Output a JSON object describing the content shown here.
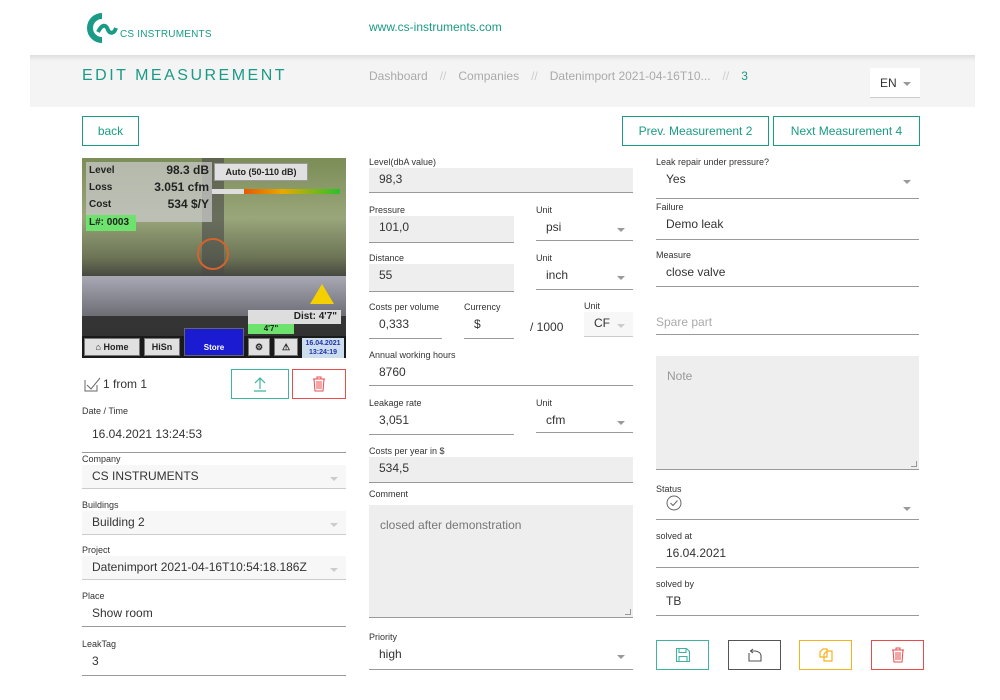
{
  "header": {
    "logo_text": "CS INSTRUMENTS",
    "site_url": "www.cs-instruments.com"
  },
  "titlebar": {
    "title": "EDIT MEASUREMENT",
    "breadcrumb": [
      "Dashboard",
      "Companies",
      "Datenimport 2021-04-16T10...",
      "3"
    ],
    "breadcrumb_separator": "//",
    "language": "EN"
  },
  "nav": {
    "back_label": "back",
    "prev_label": "Prev. Measurement 2",
    "next_label": "Next Measurement 4"
  },
  "photo": {
    "level_label": "Level",
    "level_value": "98.3 dB",
    "loss_label": "Loss",
    "loss_value": "3.051 cfm",
    "cost_label": "Cost",
    "cost_value": "534 $/Y",
    "leak_number": "L#: 0003",
    "range": "Auto (50-110 dB)",
    "distance": "Dist: 4'7\"",
    "distance_short": "4'7\"",
    "home_label": "Home",
    "hisn_label": "HiSn",
    "store_label": "Store",
    "date": "16.04.2021",
    "time": "13:24:19"
  },
  "images": {
    "count_text": "1 from 1"
  },
  "left_fields": {
    "datetime": {
      "label": "Date / Time",
      "value": "16.04.2021 13:24:53"
    },
    "company": {
      "label": "Company",
      "value": "CS INSTRUMENTS"
    },
    "buildings": {
      "label": "Buildings",
      "value": "Building 2"
    },
    "project": {
      "label": "Project",
      "value": "Datenimport 2021-04-16T10:54:18.186Z"
    },
    "place": {
      "label": "Place",
      "value": "Show room"
    },
    "leaktag": {
      "label": "LeakTag",
      "value": "3"
    }
  },
  "middle_fields": {
    "level": {
      "label": "Level(dbA value)",
      "value": "98,3"
    },
    "pressure": {
      "label": "Pressure",
      "value": "101,0"
    },
    "pressure_unit": {
      "label": "Unit",
      "value": "psi"
    },
    "distance": {
      "label": "Distance",
      "value": "55"
    },
    "distance_unit": {
      "label": "Unit",
      "value": "inch"
    },
    "costs_per_volume": {
      "label": "Costs per volume",
      "value": "0,333"
    },
    "currency": {
      "label": "Currency",
      "value": "$"
    },
    "per_volume": "/ 1000",
    "volume_unit": {
      "label": "Unit",
      "value": "CF"
    },
    "working_hours": {
      "label": "Annual working hours",
      "value": "8760"
    },
    "leakage_rate": {
      "label": "Leakage rate",
      "value": "3,051"
    },
    "leakage_unit": {
      "label": "Unit",
      "value": "cfm"
    },
    "costs_per_year": {
      "label": "Costs per year in $",
      "value": "534,5"
    },
    "comment": {
      "label": "Comment",
      "value": "closed after demonstration"
    },
    "priority": {
      "label": "Priority",
      "value": "high"
    }
  },
  "right_fields": {
    "repair_under_pressure": {
      "label": "Leak repair under pressure?",
      "value": "Yes"
    },
    "failure": {
      "label": "Failure",
      "value": "Demo leak"
    },
    "measure": {
      "label": "Measure",
      "value": "close valve"
    },
    "spare_part": {
      "placeholder": "Spare part"
    },
    "note": {
      "placeholder": "Note"
    },
    "status": {
      "label": "Status",
      "icon": "check-circle-icon"
    },
    "solved_at": {
      "label": "solved at",
      "value": "16.04.2021"
    },
    "solved_by": {
      "label": "solved by",
      "value": "TB"
    }
  },
  "actions": {
    "save_color": "#3fb39f",
    "revert_color": "#555555",
    "copy_color": "#f5b21f",
    "delete_color": "#e94b4b"
  }
}
